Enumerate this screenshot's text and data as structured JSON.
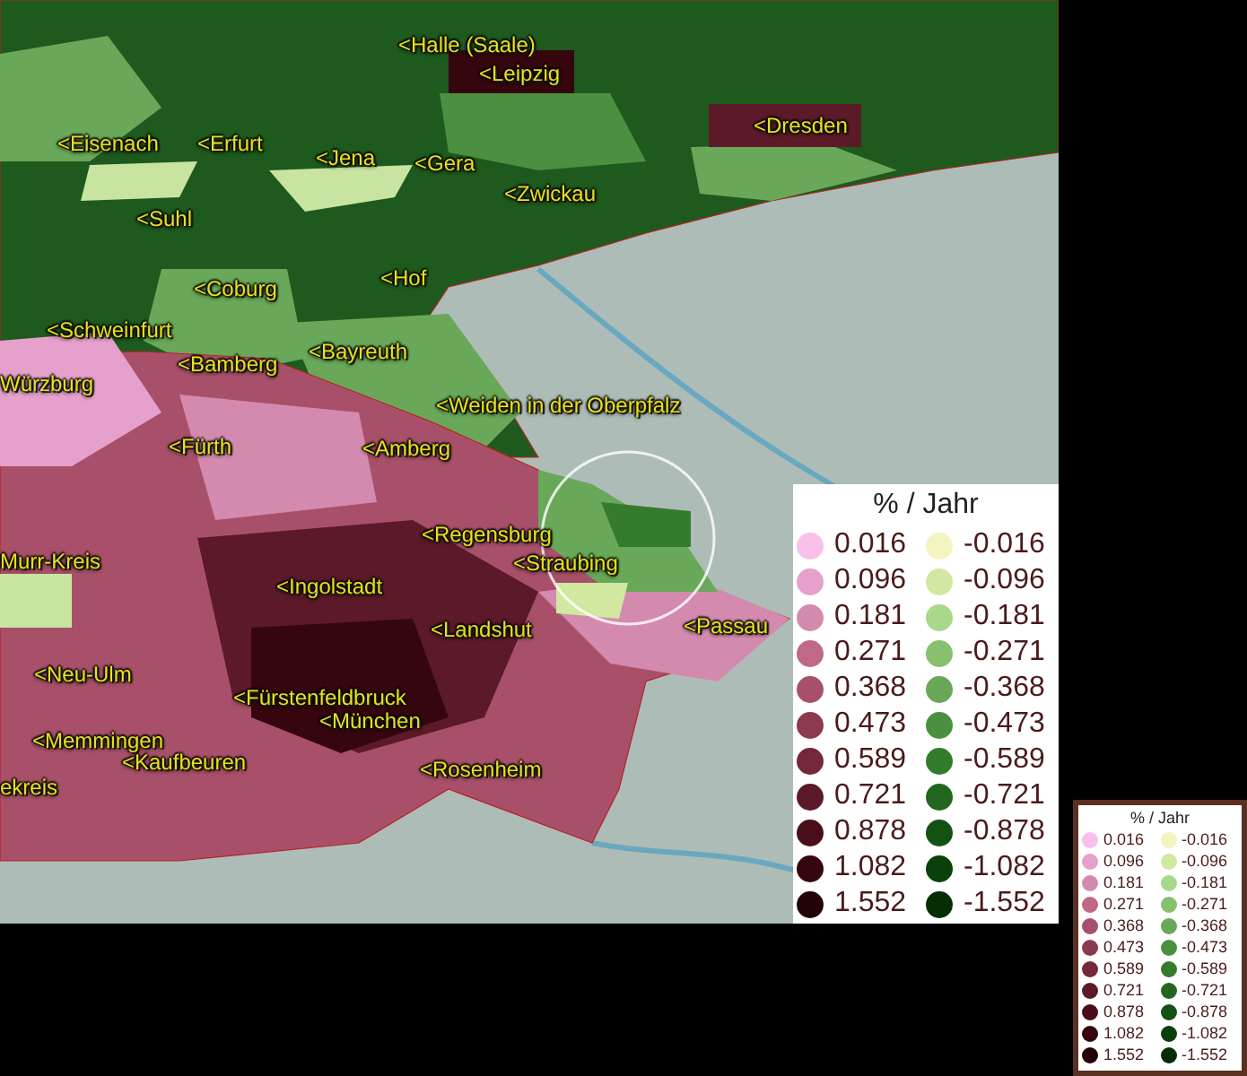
{
  "map": {
    "cities": [
      {
        "name": "<Halle (Saale)"
      },
      {
        "name": "<Leipzig"
      },
      {
        "name": "<Dresden"
      },
      {
        "name": "<Eisenach"
      },
      {
        "name": "<Erfurt"
      },
      {
        "name": "<Jena"
      },
      {
        "name": "<Gera"
      },
      {
        "name": "<Zwickau"
      },
      {
        "name": "<Suhl"
      },
      {
        "name": "<Hof"
      },
      {
        "name": "<Coburg"
      },
      {
        "name": "<Schweinfurt"
      },
      {
        "name": "<Bayreuth"
      },
      {
        "name": "<Bamberg"
      },
      {
        "name": "Würzburg"
      },
      {
        "name": "<Weiden in der Oberpfalz"
      },
      {
        "name": "<Fürth"
      },
      {
        "name": "<Amberg"
      },
      {
        "name": "<Regensburg"
      },
      {
        "name": "<Straubing"
      },
      {
        "name": "Murr-Kreis"
      },
      {
        "name": "<Ingolstadt"
      },
      {
        "name": "<Passau"
      },
      {
        "name": "<Landshut"
      },
      {
        "name": "<Neu-Ulm"
      },
      {
        "name": "<Fürstenfeldbruck"
      },
      {
        "name": "<München"
      },
      {
        "name": "<Memmingen"
      },
      {
        "name": "<Kaufbeuren"
      },
      {
        "name": "<Rosenheim"
      },
      {
        "name": "ekreis"
      }
    ]
  },
  "legend": {
    "title": "% / Jahr",
    "rows": [
      {
        "positive": {
          "value": "0.016",
          "color": "#f9c0ec"
        },
        "negative": {
          "value": "-0.016",
          "color": "#f4f4c0"
        }
      },
      {
        "positive": {
          "value": "0.096",
          "color": "#e6a0cc"
        },
        "negative": {
          "value": "-0.096",
          "color": "#d0e8a0"
        }
      },
      {
        "positive": {
          "value": "0.181",
          "color": "#d48aae"
        },
        "negative": {
          "value": "-0.181",
          "color": "#a8d88a"
        }
      },
      {
        "positive": {
          "value": "0.271",
          "color": "#c06888"
        },
        "negative": {
          "value": "-0.271",
          "color": "#88c070"
        }
      },
      {
        "positive": {
          "value": "0.368",
          "color": "#a8506a"
        },
        "negative": {
          "value": "-0.368",
          "color": "#68a858"
        }
      },
      {
        "positive": {
          "value": "0.473",
          "color": "#8c3a50"
        },
        "negative": {
          "value": "-0.473",
          "color": "#4a9040"
        }
      },
      {
        "positive": {
          "value": "0.589",
          "color": "#74283a"
        },
        "negative": {
          "value": "-0.589",
          "color": "#347c2c"
        }
      },
      {
        "positive": {
          "value": "0.721",
          "color": "#5c1a28"
        },
        "negative": {
          "value": "-0.721",
          "color": "#226620"
        }
      },
      {
        "positive": {
          "value": "0.878",
          "color": "#4a0e1a"
        },
        "negative": {
          "value": "-0.878",
          "color": "#145214"
        }
      },
      {
        "positive": {
          "value": "1.082",
          "color": "#36060e"
        },
        "negative": {
          "value": "-1.082",
          "color": "#0a400a"
        }
      },
      {
        "positive": {
          "value": "1.552",
          "color": "#220206"
        },
        "negative": {
          "value": "-1.552",
          "color": "#052e05"
        }
      }
    ]
  },
  "mini_legend": {
    "title": "% / Jahr",
    "rows": [
      {
        "positive": {
          "value": "0.016",
          "color": "#f9c0ec"
        },
        "negative": {
          "value": "-0.016",
          "color": "#f4f4c0"
        }
      },
      {
        "positive": {
          "value": "0.096",
          "color": "#e6a0cc"
        },
        "negative": {
          "value": "-0.096",
          "color": "#d0e8a0"
        }
      },
      {
        "positive": {
          "value": "0.181",
          "color": "#d48aae"
        },
        "negative": {
          "value": "-0.181",
          "color": "#a8d88a"
        }
      },
      {
        "positive": {
          "value": "0.271",
          "color": "#c06888"
        },
        "negative": {
          "value": "-0.271",
          "color": "#88c070"
        }
      },
      {
        "positive": {
          "value": "0.368",
          "color": "#a8506a"
        },
        "negative": {
          "value": "-0.368",
          "color": "#68a858"
        }
      },
      {
        "positive": {
          "value": "0.473",
          "color": "#8c3a50"
        },
        "negative": {
          "value": "-0.473",
          "color": "#4a9040"
        }
      },
      {
        "positive": {
          "value": "0.589",
          "color": "#74283a"
        },
        "negative": {
          "value": "-0.589",
          "color": "#347c2c"
        }
      },
      {
        "positive": {
          "value": "0.721",
          "color": "#5c1a28"
        },
        "negative": {
          "value": "-0.721",
          "color": "#226620"
        }
      },
      {
        "positive": {
          "value": "0.878",
          "color": "#4a0e1a"
        },
        "negative": {
          "value": "-0.878",
          "color": "#145214"
        }
      },
      {
        "positive": {
          "value": "1.082",
          "color": "#36060e"
        },
        "negative": {
          "value": "-1.082",
          "color": "#0a400a"
        }
      },
      {
        "positive": {
          "value": "1.552",
          "color": "#220206"
        },
        "negative": {
          "value": "-1.552",
          "color": "#052e05"
        }
      }
    ]
  }
}
